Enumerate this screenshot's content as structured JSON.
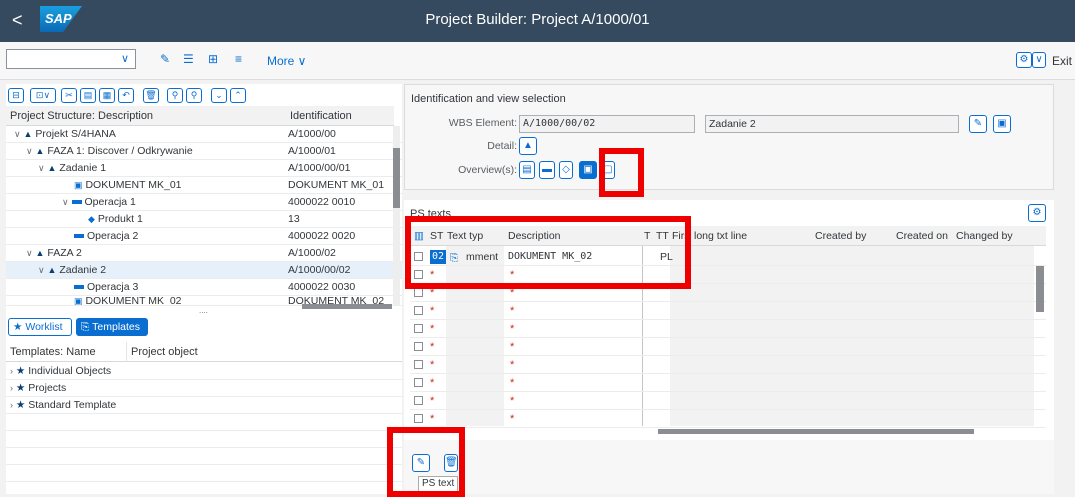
{
  "header": {
    "logo": "SAP",
    "title": "Project Builder: Project A/1000/01",
    "back": "<"
  },
  "toolbar": {
    "more": "More ∨",
    "exit": "Exit"
  },
  "structure": {
    "col_desc": "Project Structure: Description",
    "col_ident": "Identification",
    "rows": [
      {
        "desc": "Projekt S/4HANA",
        "ident": "A/1000/00"
      },
      {
        "desc": "FAZA 1: Discover / Odkrywanie",
        "ident": "A/1000/01"
      },
      {
        "desc": "Zadanie 1",
        "ident": "A/1000/00/01"
      },
      {
        "desc": "DOKUMENT MK_01",
        "ident": "DOKUMENT MK_01"
      },
      {
        "desc": "Operacja 1",
        "ident": "4000022 0010"
      },
      {
        "desc": "Produkt 1",
        "ident": "13"
      },
      {
        "desc": "Operacja 2",
        "ident": "4000022 0020"
      },
      {
        "desc": "FAZA 2",
        "ident": "A/1000/02"
      },
      {
        "desc": "Zadanie 2",
        "ident": "A/1000/00/02"
      },
      {
        "desc": "Operacja 3",
        "ident": "4000022 0030"
      },
      {
        "desc": "DOKUMENT MK_02",
        "ident": "DOKUMENT MK_02"
      }
    ],
    "dots": "...."
  },
  "tabs": {
    "worklist": "Worklist",
    "templates": "Templates"
  },
  "templates": {
    "col_name": "Templates: Name",
    "col_obj": "Project object",
    "rows": [
      "Individual Objects",
      "Projects",
      "Standard Template"
    ]
  },
  "idpanel": {
    "title": "Identification and view selection",
    "wbs_label": "WBS Element:",
    "wbs_value": "A/1000/00/02",
    "wbs_desc": "Zadanie 2",
    "detail_label": "Detail:",
    "overview_label": "Overview(s):"
  },
  "pstexts": {
    "title": "PS texts",
    "cols": {
      "st": "ST",
      "texttype": "Text typ",
      "desc": "Description",
      "t": "T",
      "tt": "TT",
      "first": "Firs",
      "long": "long txt line",
      "created_by": "Created by",
      "created_on": "Created on",
      "changed_by": "Changed by"
    },
    "row1": {
      "st": "02",
      "texttype": "mment",
      "desc": "DOKUMENT MK_02",
      "tt": "PL"
    },
    "star": "*"
  },
  "tooltip": "PS text"
}
